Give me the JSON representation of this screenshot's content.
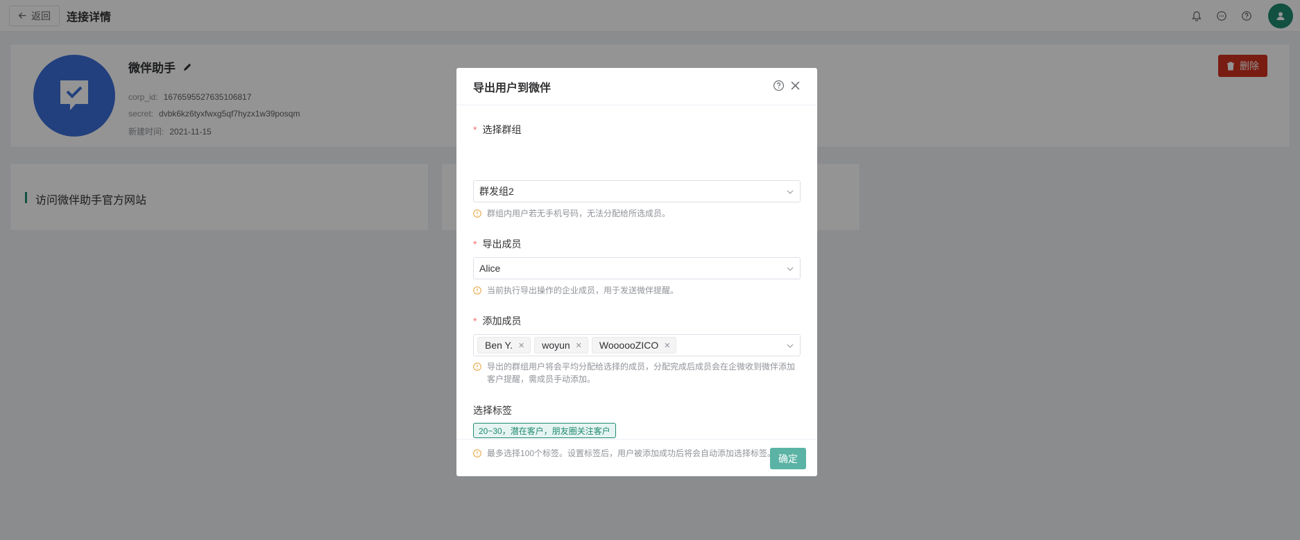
{
  "header": {
    "back_label": "返回",
    "title": "连接详情"
  },
  "profile": {
    "name": "微伴助手",
    "corp_id_label": "corp_id:",
    "corp_id": "1676595527635106817",
    "secret_label": "secret:",
    "secret": "dvbk6kz6tyxfwxg5qf7hyzx1w39posqm",
    "created_label": "新建时间:",
    "created": "2021-11-15",
    "delete_label": "删除"
  },
  "cards": [
    {
      "label": "访问微伴助手官方网站"
    }
  ],
  "modal": {
    "title": "导出用户到微伴",
    "group": {
      "label": "选择群组",
      "value": "群发组2",
      "hint": "群组内用户若无手机号码，无法分配给所选成员。"
    },
    "member": {
      "label": "导出成员",
      "value": "Alice",
      "hint": "当前执行导出操作的企业成员，用于发送微伴提醒。"
    },
    "add_members": {
      "label": "添加成员",
      "chips": [
        "Ben Y.",
        "woyun",
        "WoooooZICO"
      ],
      "hint": "导出的群组用户将会平均分配给选择的成员，分配完成后成员会在企微收到微伴添加客户提醒，需成员手动添加。"
    },
    "tags": {
      "label": "选择标签",
      "value": "20~30，潜在客户，朋友圈关注客户",
      "hint": "最多选择100个标签。设置标签后，用户被添加成功后将会自动添加选择标签。"
    },
    "confirm_label": "确定"
  },
  "colors": {
    "accent": "#1f8a70",
    "danger": "#d1321f",
    "logo_bg": "#3b6fd9",
    "warn": "#e6a23c"
  },
  "icons": [
    "arrow-left-icon",
    "bell-icon",
    "chat-icon",
    "help-icon",
    "user-icon",
    "chat-check-icon",
    "pencil-icon",
    "trash-icon",
    "close-icon",
    "chevron-down-icon",
    "warning-icon"
  ]
}
